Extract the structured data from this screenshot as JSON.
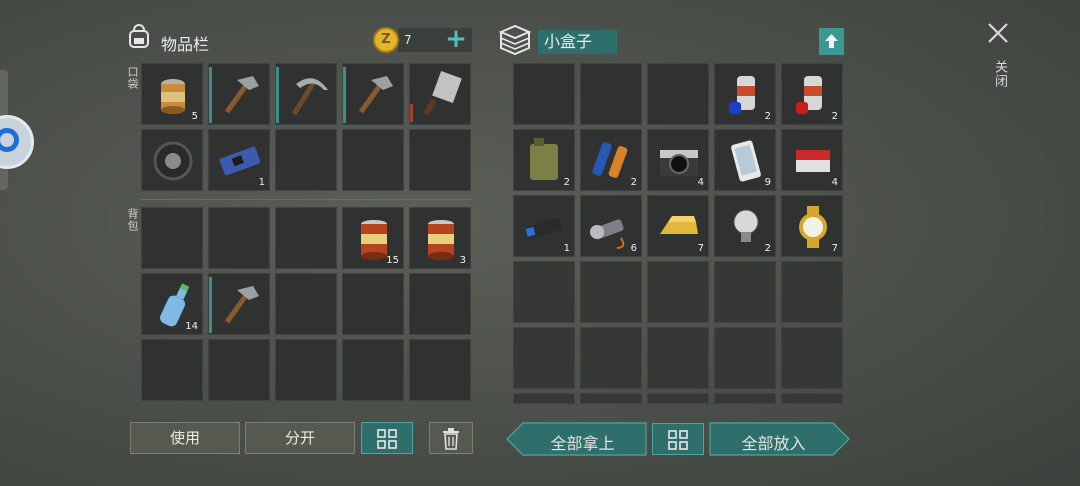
{
  "inventory": {
    "title": "物品栏",
    "coin_count": "7",
    "pocket_label": "口袋",
    "backpack_label": "背包",
    "pocket_slots": [
      {
        "item": "canned-food-open",
        "count": "5"
      },
      {
        "item": "hammer",
        "count": ""
      },
      {
        "item": "pickaxe",
        "count": ""
      },
      {
        "item": "hammer",
        "count": ""
      },
      {
        "item": "cleaver",
        "count": ""
      },
      {
        "item": "wheel",
        "count": ""
      },
      {
        "item": "circuit-board",
        "count": "1"
      },
      {
        "item": "",
        "count": ""
      },
      {
        "item": "",
        "count": ""
      },
      {
        "item": "",
        "count": ""
      }
    ],
    "backpack_slots": [
      {
        "item": "",
        "count": ""
      },
      {
        "item": "",
        "count": ""
      },
      {
        "item": "",
        "count": ""
      },
      {
        "item": "canned-food",
        "count": "15"
      },
      {
        "item": "canned-food",
        "count": "3"
      },
      {
        "item": "water-bottle",
        "count": "14"
      },
      {
        "item": "hammer",
        "count": ""
      },
      {
        "item": "",
        "count": ""
      },
      {
        "item": "",
        "count": ""
      },
      {
        "item": "",
        "count": ""
      },
      {
        "item": "",
        "count": ""
      },
      {
        "item": "",
        "count": ""
      },
      {
        "item": "",
        "count": ""
      },
      {
        "item": "",
        "count": ""
      },
      {
        "item": "",
        "count": ""
      }
    ],
    "buttons": {
      "use": "使用",
      "split": "分开"
    }
  },
  "container": {
    "title": "小盒子",
    "slots": [
      {
        "item": "",
        "count": ""
      },
      {
        "item": "",
        "count": ""
      },
      {
        "item": "",
        "count": ""
      },
      {
        "item": "spray-paint-blue",
        "count": "2"
      },
      {
        "item": "spray-paint-red",
        "count": "2"
      },
      {
        "item": "jerry-can",
        "count": "2"
      },
      {
        "item": "batteries",
        "count": "2"
      },
      {
        "item": "camera",
        "count": "4"
      },
      {
        "item": "smartphone",
        "count": "9"
      },
      {
        "item": "cigarettes",
        "count": "4"
      },
      {
        "item": "usb-drive",
        "count": "1"
      },
      {
        "item": "flashlight",
        "count": "6"
      },
      {
        "item": "gold-bar",
        "count": "7"
      },
      {
        "item": "light-bulb",
        "count": "2"
      },
      {
        "item": "gold-watch",
        "count": "7"
      }
    ],
    "buttons": {
      "take_all": "全部拿上",
      "put_all": "全部放入"
    }
  },
  "close_label": "关闭",
  "colors": {
    "teal": "#2e6f6c",
    "slot": "#2f3230",
    "accent": "#3c8f8f"
  }
}
